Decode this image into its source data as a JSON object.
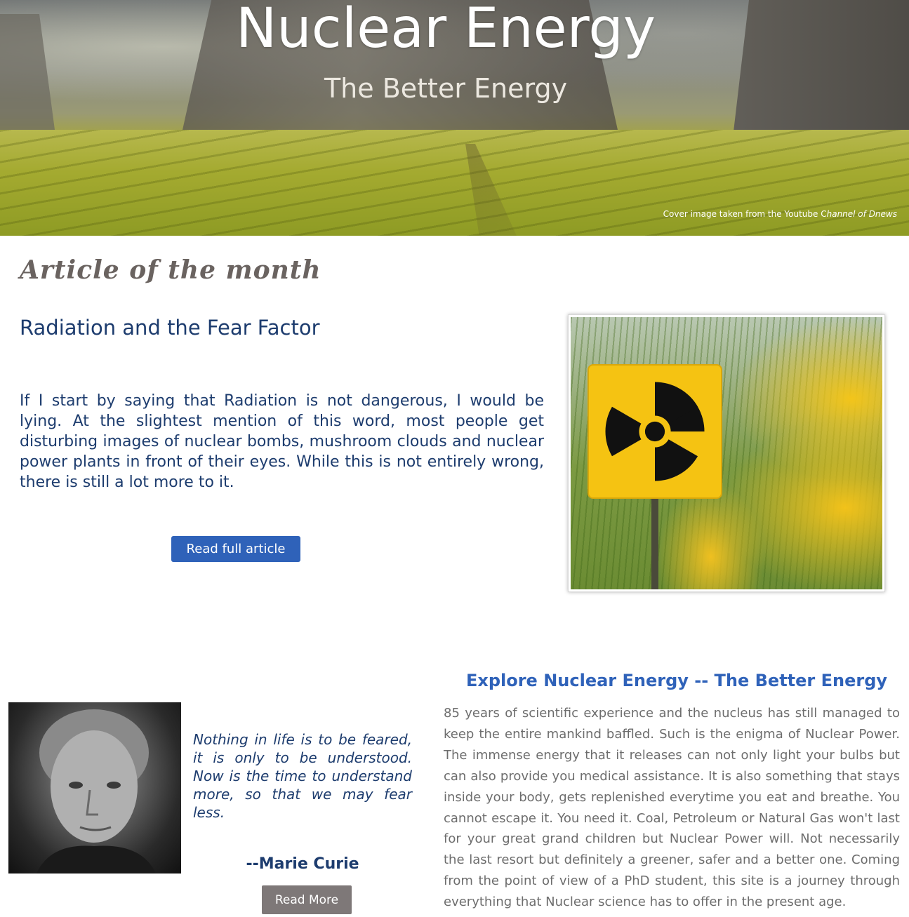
{
  "hero": {
    "title": "Nuclear Energy",
    "subtitle": "The Better Energy",
    "credit_prefix": "Cover image taken from the Youtube C",
    "credit_italic": "hannel of Dnews"
  },
  "article_of_month": {
    "heading": "Article of the month",
    "title": "Radiation and the Fear Factor",
    "body": "If I start by saying that Radiation is not dangerous, I would be lying. At the slightest mention of this word, most people get disturbing images of nuclear bombs, mushroom clouds and nuclear power plants in front of their eyes. While this is not entirely wrong, there is still a lot more to it.",
    "button_label": "Read full article"
  },
  "quote": {
    "text": "Nothing in life is to be feared, it is only to be understood. Now is the time to understand more, so that we may fear less.",
    "author": "--Marie Curie",
    "button_label": "Read More"
  },
  "explore": {
    "title": "Explore Nuclear Energy -- The Better Energy",
    "body": "85 years of scientific experience and the nucleus has still managed to keep the entire mankind baffled. Such is the enigma of Nuclear Power. The immense energy that it releases can not only light your bulbs but can also provide you medical assistance. It is also something that stays inside your body, gets replenished everytime you eat and breathe.  You cannot escape it. You need it. Coal, Petroleum or Natural Gas won't last for your great grand children but Nuclear Power will. Not necessarily the last resort but definitely a greener, safer and a better one. Coming from the point of view of a PhD student, this site is a journey through everything that Nuclear science has to offer in the present age."
  },
  "colors": {
    "navy_text": "#1d3c6e",
    "accent_blue": "#2f62b9",
    "gray_button": "#7e7878",
    "body_gray": "#6d6d6d",
    "sign_yellow": "#f5c312"
  },
  "icons": {
    "radiation_sign": "radiation-trefoil-icon"
  }
}
